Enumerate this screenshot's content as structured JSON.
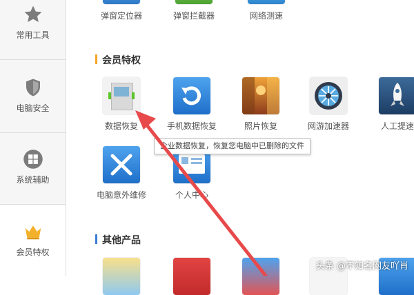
{
  "sidebar": {
    "items": [
      {
        "label": "常用工具",
        "icon": "star-icon"
      },
      {
        "label": "电脑安全",
        "icon": "shield-icon"
      },
      {
        "label": "系统辅助",
        "icon": "windows-icon"
      },
      {
        "label": "会员特权",
        "icon": "crown-icon"
      }
    ]
  },
  "top_row": [
    {
      "label": "弹窗定位器"
    },
    {
      "label": "弹窗拦截器"
    },
    {
      "label": "网络测速"
    }
  ],
  "member_section": {
    "title": "会员特权",
    "tiles": [
      {
        "label": "数据恢复",
        "icon": "data-recovery-icon"
      },
      {
        "label": "手机数据恢复",
        "icon": "phone-recovery-icon"
      },
      {
        "label": "照片恢复",
        "icon": "photo-recovery-icon"
      },
      {
        "label": "网游加速器",
        "icon": "game-accelerator-icon"
      },
      {
        "label": "人工提速",
        "icon": "rocket-icon"
      },
      {
        "label": "电脑意外维修",
        "icon": "repair-tools-icon"
      },
      {
        "label": "个人中心",
        "icon": "profile-card-icon"
      }
    ]
  },
  "tooltip": {
    "text": "企业数据恢复，恢复您电脑中已删除的文件"
  },
  "other_section": {
    "title": "其他产品"
  },
  "watermark": "头条 @不知名网友吖肖",
  "colors": {
    "accent_orange": "#f5a623",
    "accent_blue": "#3a7bd5",
    "arrow_red": "#e8494a"
  }
}
